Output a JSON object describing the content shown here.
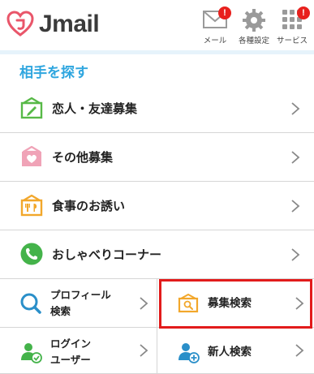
{
  "app": {
    "logo_text": "Jmail",
    "brand_color": "#e9566a"
  },
  "header": {
    "buttons": [
      {
        "name": "mail",
        "label": "メール",
        "badge": "!"
      },
      {
        "name": "settings",
        "label": "各種設定"
      },
      {
        "name": "services",
        "label": "サービス",
        "badge": "!"
      }
    ]
  },
  "section": {
    "title": "相手を探す",
    "accent": "#2fa6df"
  },
  "menu": {
    "items": [
      {
        "label": "恋人・友達募集",
        "icon": "board-pencil-icon",
        "color": "#57b947"
      },
      {
        "label": "その他募集",
        "icon": "board-heart-icon",
        "color": "#f0a3b7"
      },
      {
        "label": "食事のお誘い",
        "icon": "board-food-icon",
        "color": "#f2a72b"
      },
      {
        "label": "おしゃべりコーナー",
        "icon": "phone-icon",
        "color": "#44b34a"
      }
    ],
    "grid": [
      {
        "label_line1": "プロフィール",
        "label_line2": "検索",
        "icon": "magnifier-icon",
        "color": "#2a8fc9"
      },
      {
        "label_line1": "募集検索",
        "label_line2": "",
        "icon": "board-search-icon",
        "color": "#f2a72b"
      },
      {
        "label_line1": "ログイン",
        "label_line2": "ユーザー",
        "icon": "user-check-icon",
        "color": "#44b34a"
      },
      {
        "label_line1": "新人検索",
        "label_line2": "",
        "icon": "user-plus-icon",
        "color": "#2a8fc9"
      }
    ]
  }
}
